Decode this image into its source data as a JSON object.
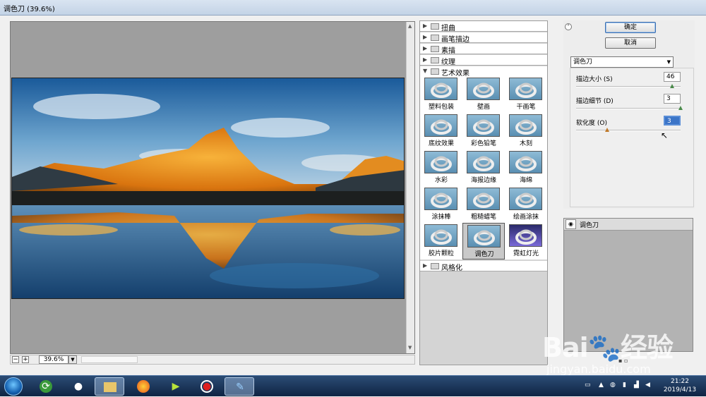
{
  "window": {
    "title": "调色刀 (39.6%)"
  },
  "preview": {
    "zoom": "39.6%",
    "zoom_minus": "−",
    "zoom_plus": "+"
  },
  "categories": [
    {
      "label": "扭曲",
      "expanded": false
    },
    {
      "label": "画笔描边",
      "expanded": false
    },
    {
      "label": "素描",
      "expanded": false
    },
    {
      "label": "纹理",
      "expanded": false
    },
    {
      "label": "艺术效果",
      "expanded": true
    },
    {
      "label": "风格化",
      "expanded": false
    }
  ],
  "thumbnails": [
    {
      "label": "塑料包装",
      "selected": false
    },
    {
      "label": "壁画",
      "selected": false
    },
    {
      "label": "干画笔",
      "selected": false
    },
    {
      "label": "底纹效果",
      "selected": false
    },
    {
      "label": "彩色铅笔",
      "selected": false
    },
    {
      "label": "木刻",
      "selected": false
    },
    {
      "label": "水彩",
      "selected": false
    },
    {
      "label": "海报边缘",
      "selected": false
    },
    {
      "label": "海绵",
      "selected": false
    },
    {
      "label": "涂抹棒",
      "selected": false
    },
    {
      "label": "粗糙蜡笔",
      "selected": false
    },
    {
      "label": "绘画涂抹",
      "selected": false
    },
    {
      "label": "胶片颗粒",
      "selected": false
    },
    {
      "label": "调色刀",
      "selected": true
    },
    {
      "label": "霓虹灯光",
      "selected": false
    }
  ],
  "buttons": {
    "ok": "确定",
    "cancel": "取消"
  },
  "filter_select": "调色刀",
  "params": [
    {
      "label": "描边大小 (S)",
      "value": "46",
      "fraction": 0.92
    },
    {
      "label": "描边细节 (D)",
      "value": "3",
      "fraction": 1.0
    },
    {
      "label": "软化度 (O)",
      "value": "3",
      "fraction": 0.3
    }
  ],
  "layer": {
    "name": "调色刀"
  },
  "watermark": {
    "brand": "Bai🐾经验",
    "url": "jingyan.baidu.com"
  },
  "clock": {
    "time": "21:22",
    "date": "2019/4/13"
  },
  "colors": {
    "accent": "#3b6fb0",
    "taskbar": "#1a3558",
    "preview_bg": "#9e9e9e"
  }
}
